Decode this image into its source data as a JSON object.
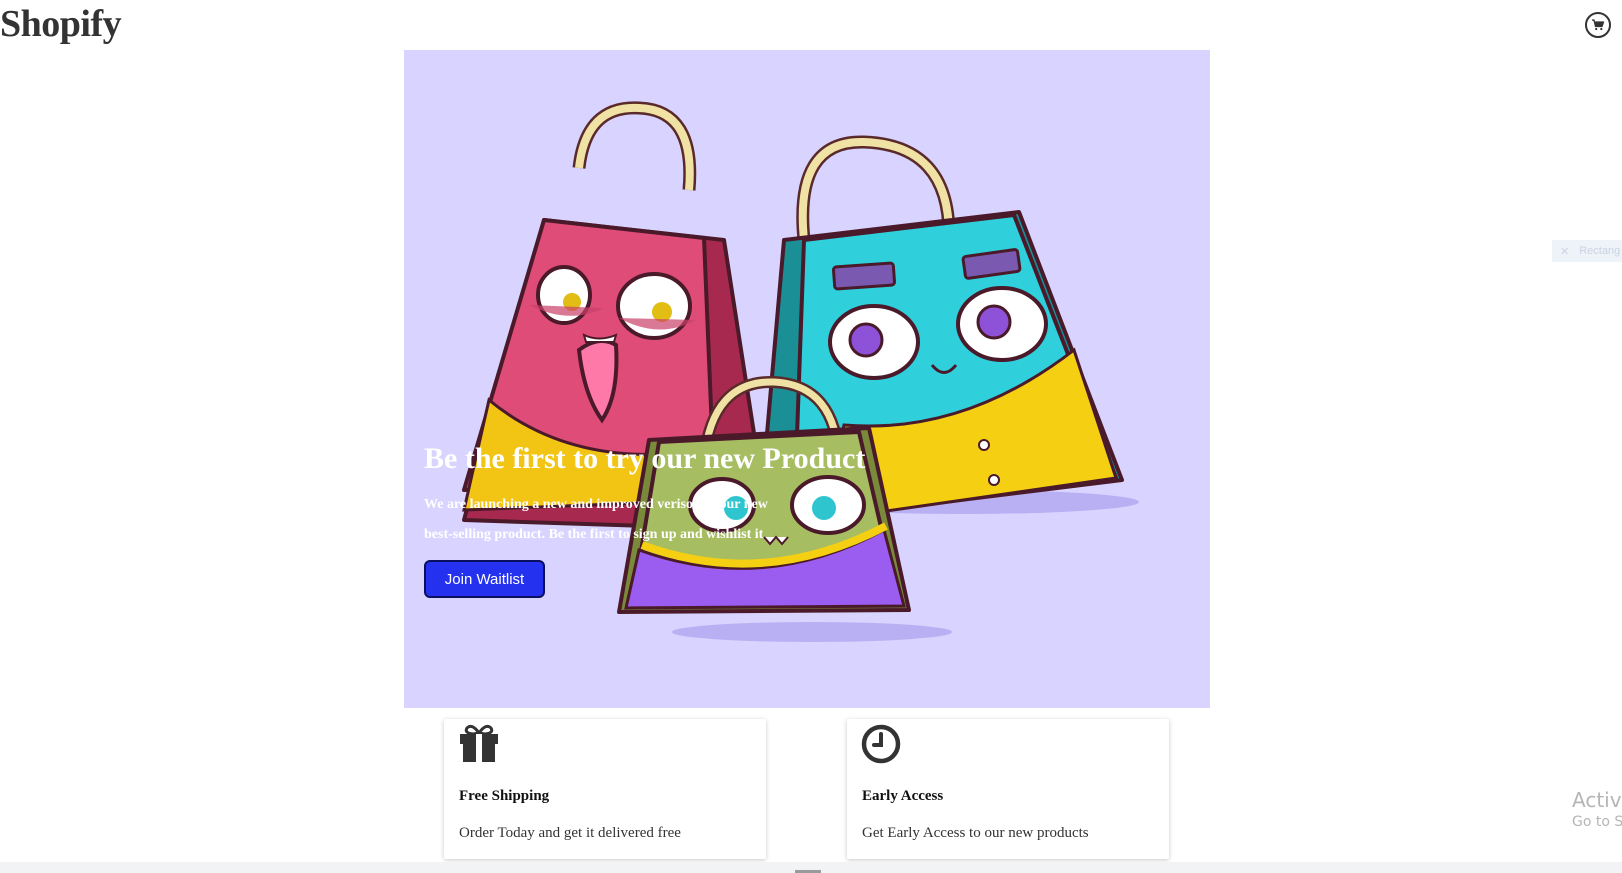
{
  "header": {
    "logo": "Shopify",
    "cart_icon": "shopping-cart-icon"
  },
  "hero": {
    "background_color": "#d8d4ff",
    "image": "cartoon-shopping-bags-illustration",
    "title": "Be the first to try our new Product",
    "description": "We are launching a new and improved verison of our new best-selling product. Be the first to sign up and wishlist it",
    "cta_label": "Join Waitlist",
    "cta_color": "#2432f0"
  },
  "features": [
    {
      "icon": "gift-icon",
      "title": "Free Shipping",
      "text": "Order Today and get it delivered free"
    },
    {
      "icon": "clock-icon",
      "title": "Early Access",
      "text": "Get Early Access to our new products"
    }
  ],
  "overlay": {
    "side_tab_label": "Rectang",
    "side_tab_icon": "close-icon",
    "activate_line1": "Activa",
    "activate_line2": "Go to S"
  }
}
